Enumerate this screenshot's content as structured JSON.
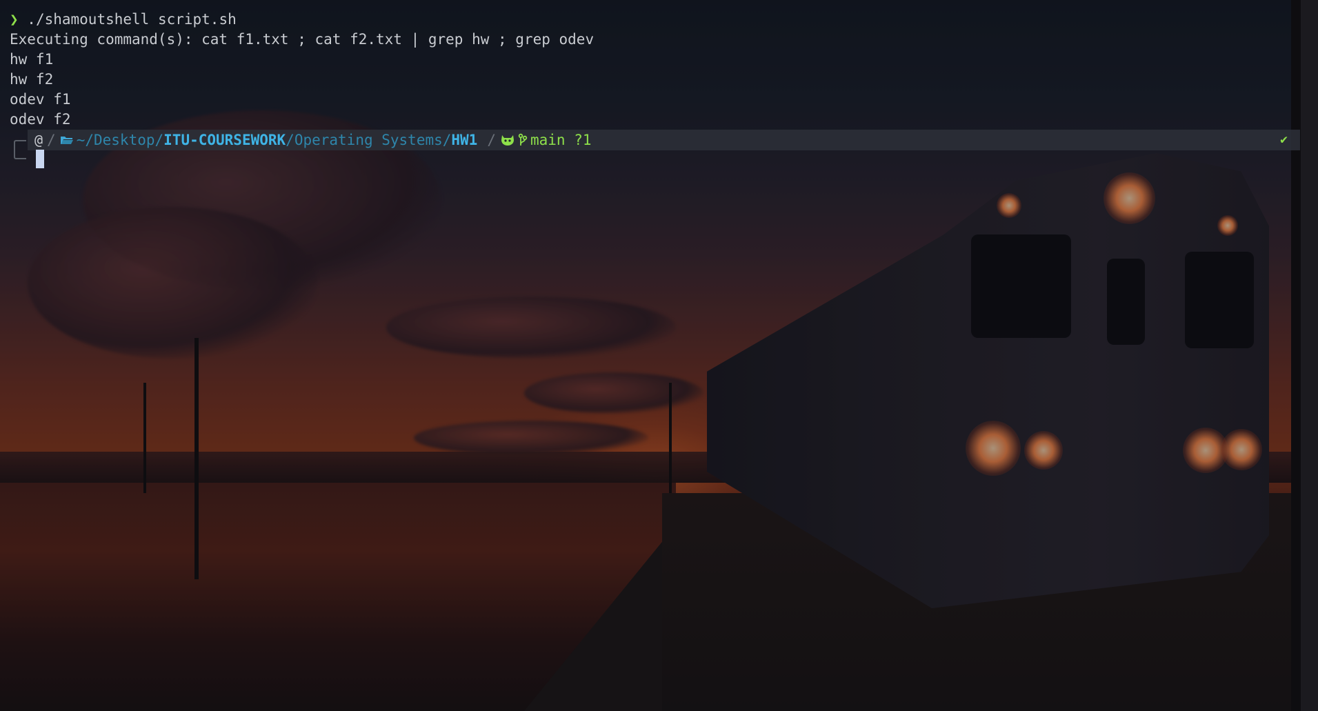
{
  "terminal": {
    "prompt_symbol": "❯",
    "command": " ./shamoutshell script.sh",
    "output": [
      "Executing command(s): cat f1.txt ; cat f2.txt | grep hw ; grep odev",
      "hw f1",
      "hw f2",
      "odev f1",
      "odev f2"
    ]
  },
  "statusbar": {
    "os_icon": "debian-swirl-icon",
    "separator": "/",
    "folder_icon": "folder-open-icon",
    "path": {
      "home": "~/",
      "seg1": "Desktop/",
      "seg2": "ITU-COURSEWORK",
      "seg3": "/Operating Systems/",
      "seg4": "HW1"
    },
    "git_icon": "github-cat-icon",
    "branch_icon": "git-branch-icon",
    "branch": "main",
    "git_status": " ?1",
    "status_ok": "✔"
  },
  "colors": {
    "prompt_green": "#8ee04a",
    "path_blue": "#2e86ab",
    "path_blue_bold": "#3fb4e6",
    "text": "#c9ccd1",
    "statusbar_bg": "#2d3038"
  }
}
